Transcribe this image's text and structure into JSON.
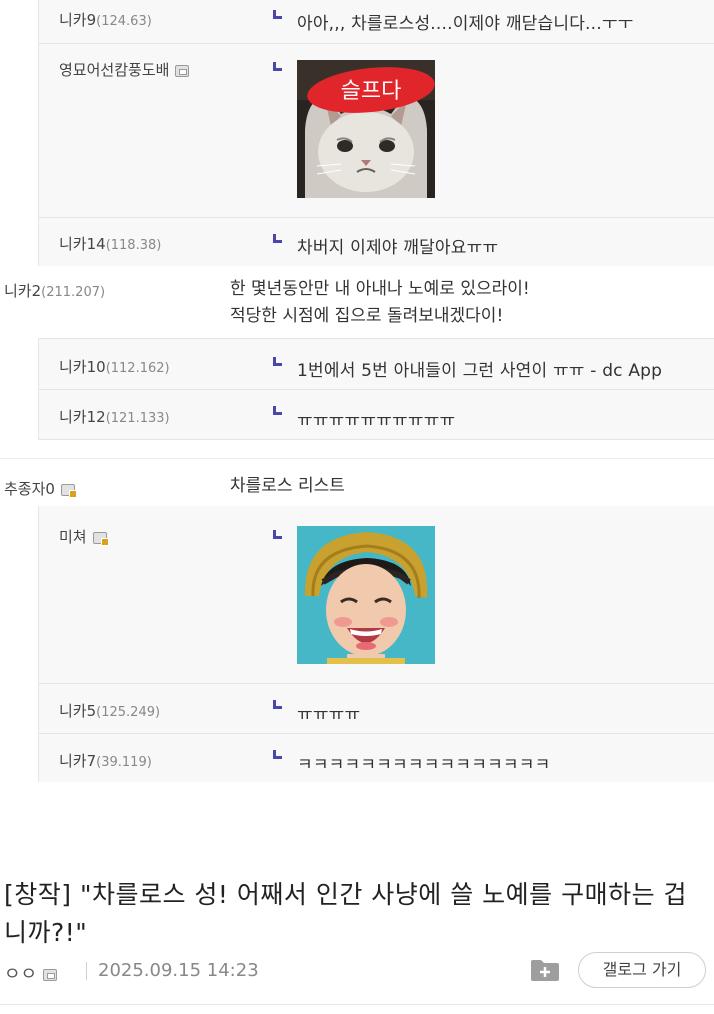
{
  "thread": [
    {
      "type": "replies",
      "replies": [
        {
          "nick": "니카9",
          "ip": "(124.63)",
          "text": "아아,,, 차를로스성....이제야 깨닫습니다...ㅜㅜ"
        },
        {
          "nick": "영묘어선캄풍도배",
          "image": "sad-cat-sticker",
          "sticker_text": "슬프다"
        },
        {
          "nick": "니카14",
          "ip": "(118.38)",
          "text": "차버지 이제야 깨달아요ㅠㅠ"
        }
      ]
    },
    {
      "type": "comment",
      "nick": "니카2",
      "ip": "(211.207)",
      "lines": [
        "한 몇년동안만 내 아내나 노예로 있으라이!",
        "적당한 시점에 집으로 돌려보내겠다이!"
      ]
    },
    {
      "type": "replies",
      "replies": [
        {
          "nick": "니카10",
          "ip": "(112.162)",
          "text": "1번에서 5번 아내들이 그런 사연이 ㅠㅠ - dc App"
        },
        {
          "nick": "니카12",
          "ip": "(121.133)",
          "text": "ㅠㅠㅠㅠㅠㅠㅠㅠㅠㅠ"
        }
      ]
    },
    {
      "type": "comment",
      "nick": "추종자0",
      "lines": [
        "차를로스 리스트"
      ]
    },
    {
      "type": "replies",
      "replies": [
        {
          "nick": "미쳐",
          "image": "laughing-avatar-sticker"
        },
        {
          "nick": "니카5",
          "ip": "(125.249)",
          "text": "ㅠㅠㅠㅠ"
        },
        {
          "nick": "니카7",
          "ip": "(39.119)",
          "text": "ㅋㅋㅋㅋㅋㅋㅋㅋㅋㅋㅋㅋㅋㅋㅋㅋ"
        }
      ]
    }
  ],
  "post": {
    "title": "[창작] \"차를로스 성! 어째서 인간 사냥에 쓸 노예를 구매하는 겁니까?!\"",
    "author": "ㅇㅇ",
    "date": "2025.09.15 14:23",
    "gallog_button": "갤로그 가기"
  },
  "colors": {
    "reply_arrow": "#4a47a8",
    "reply_background": "#f8f8f8",
    "sticker_red": "#e0262b"
  }
}
